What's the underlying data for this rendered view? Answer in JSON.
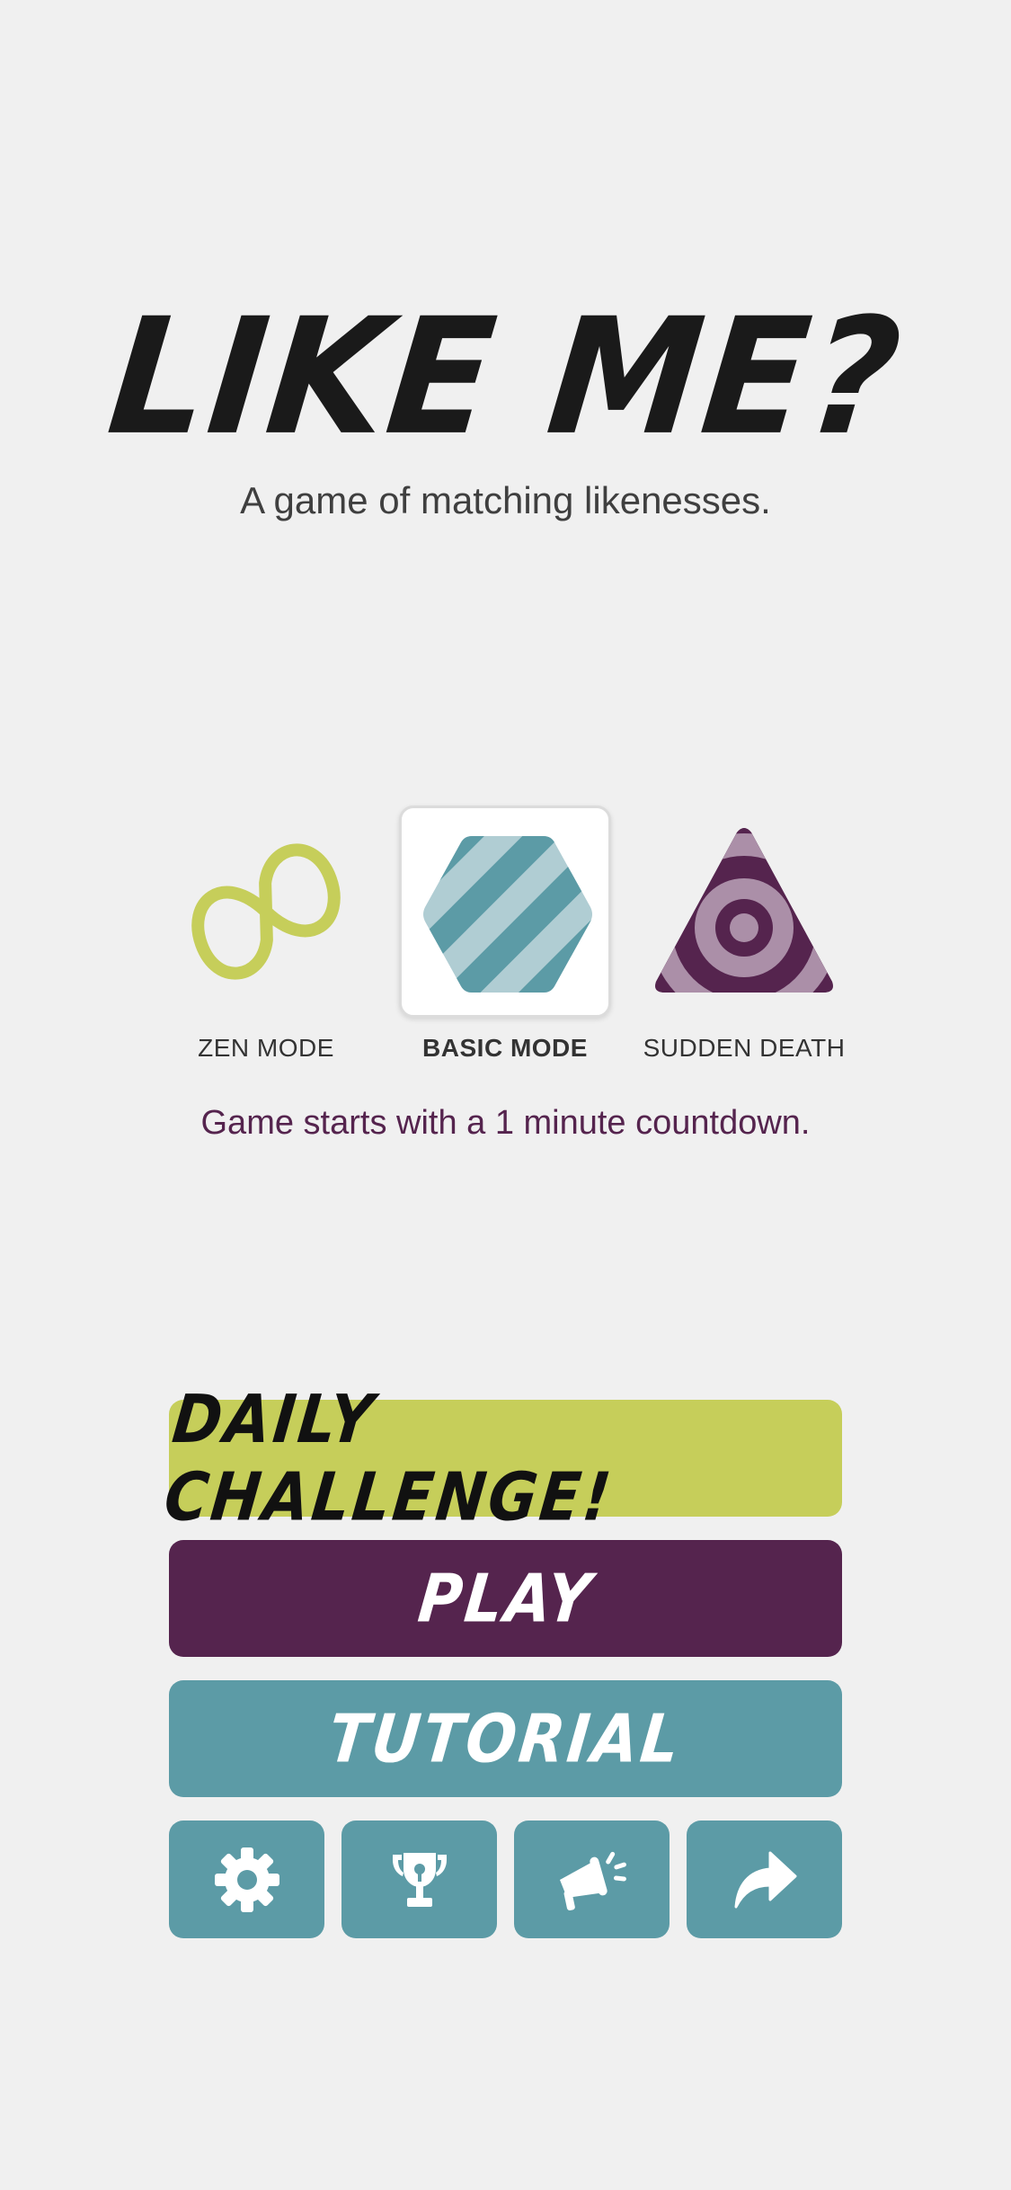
{
  "header": {
    "title": "LIKE ME?",
    "subtitle": "A game of matching likenesses."
  },
  "modes": {
    "items": [
      {
        "label": "ZEN MODE",
        "icon": "infinity-icon",
        "selected": false
      },
      {
        "label": "BASIC MODE",
        "icon": "striped-hexagon-icon",
        "selected": true
      },
      {
        "label": "SUDDEN DEATH",
        "icon": "target-triangle-icon",
        "selected": false
      }
    ],
    "description": "Game starts with a 1 minute countdown."
  },
  "buttons": {
    "daily_challenge": "DAILY CHALLENGE!",
    "play": "PLAY",
    "tutorial": "TUTORIAL"
  },
  "icon_buttons": [
    {
      "icon": "gear-icon",
      "name": "settings"
    },
    {
      "icon": "trophy-icon",
      "name": "leaderboard"
    },
    {
      "icon": "megaphone-icon",
      "name": "announcements"
    },
    {
      "icon": "share-icon",
      "name": "share"
    }
  ],
  "colors": {
    "background": "#f0f0f0",
    "lime": "#c6ce5a",
    "plum": "#55244e",
    "teal": "#5c9ba6",
    "light_teal": "#b0cdd3",
    "light_plum": "#ab8fa8"
  }
}
